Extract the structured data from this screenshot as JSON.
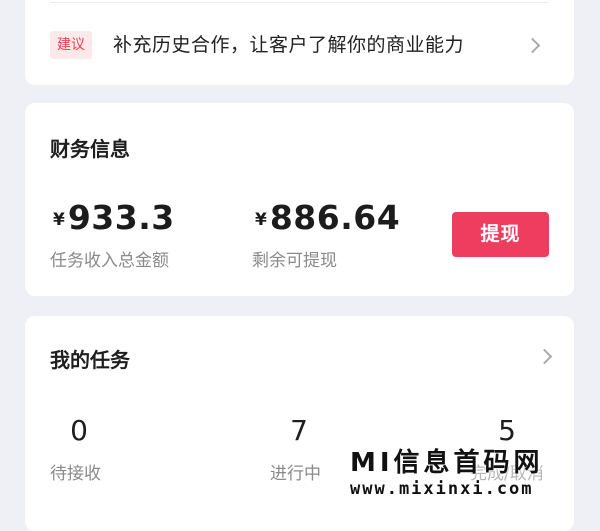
{
  "suggestion": {
    "tag": "建议",
    "text": "补充历史合作，让客户了解你的商业能力"
  },
  "finance": {
    "title": "财务信息",
    "currency_symbol": "¥",
    "total_income": "933.3",
    "total_income_label": "任务收入总金额",
    "balance": "886.64",
    "balance_label": "剩余可提现",
    "withdraw_label": "提现"
  },
  "tasks": {
    "title": "我的任务",
    "items": [
      {
        "count": "0",
        "label": "待接收"
      },
      {
        "count": "7",
        "label": "进行中"
      },
      {
        "count": "5",
        "label": "完成/取消"
      }
    ]
  },
  "watermark": {
    "line1": "MI信息首码网",
    "line2": "www.mixinxi.com"
  },
  "colors": {
    "accent": "#ef3d5f",
    "tag_background": "#fde8ea",
    "page_background": "#eef0f5"
  }
}
